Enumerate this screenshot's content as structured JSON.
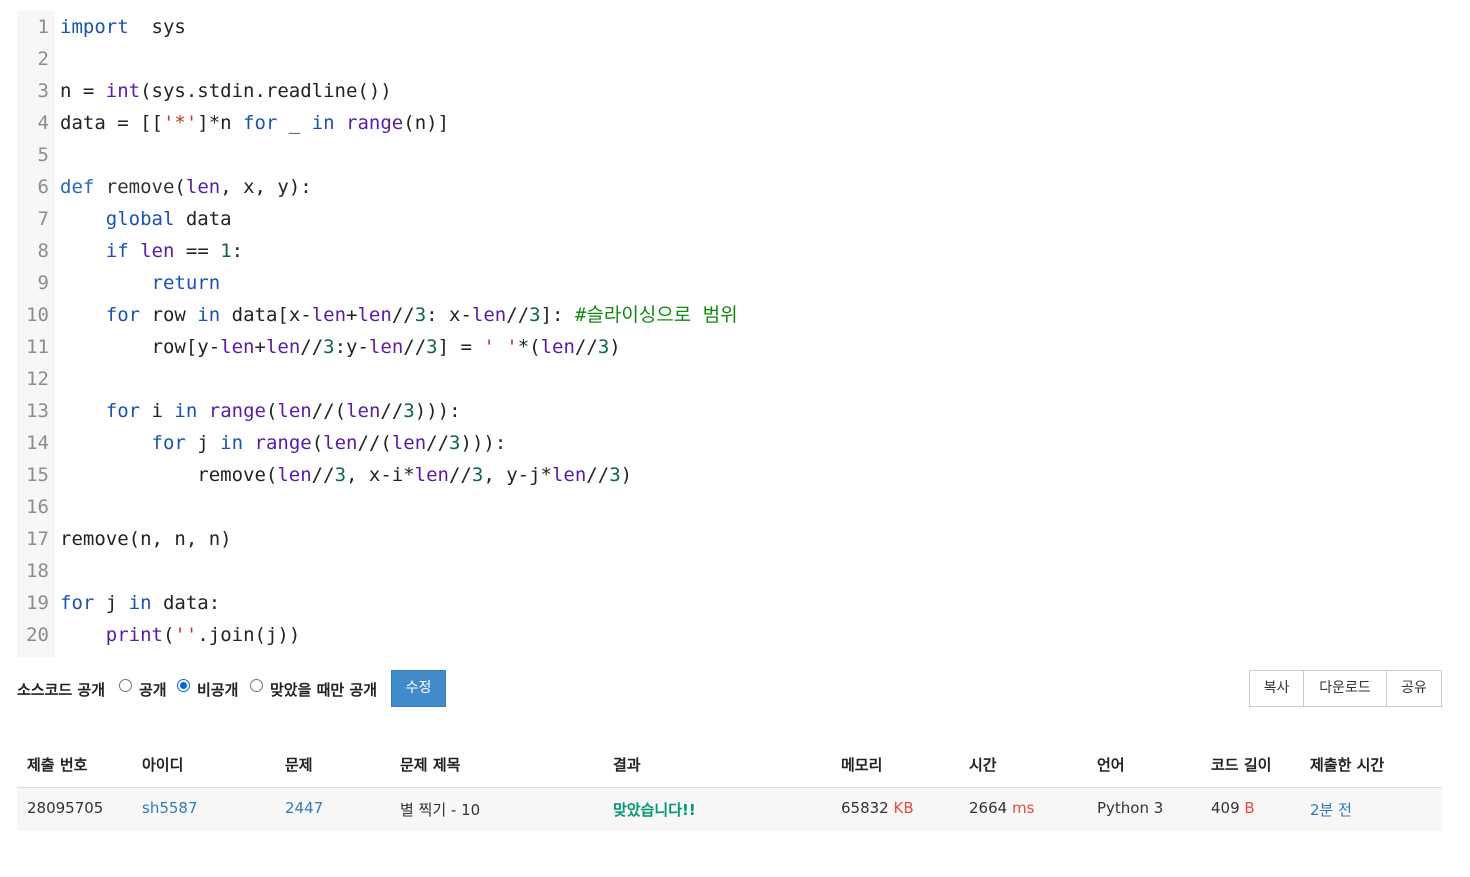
{
  "code": {
    "lines": [
      {
        "n": "1",
        "tokens": [
          [
            "kw",
            "import"
          ],
          [
            "",
            "  sys"
          ]
        ]
      },
      {
        "n": "2",
        "tokens": []
      },
      {
        "n": "3",
        "tokens": [
          [
            "",
            "n = "
          ],
          [
            "bi",
            "int"
          ],
          [
            "",
            "(sys.stdin.readline())"
          ]
        ]
      },
      {
        "n": "4",
        "tokens": [
          [
            "",
            "data = [["
          ],
          [
            "str",
            "'*'"
          ],
          [
            "",
            "]*n "
          ],
          [
            "kw",
            "for"
          ],
          [
            "",
            " _ "
          ],
          [
            "kw",
            "in"
          ],
          [
            "",
            " "
          ],
          [
            "bi",
            "range"
          ],
          [
            "",
            "(n)]"
          ]
        ]
      },
      {
        "n": "5",
        "tokens": []
      },
      {
        "n": "6",
        "tokens": [
          [
            "def",
            "def"
          ],
          [
            "",
            " "
          ],
          [
            "fn",
            "remove"
          ],
          [
            "",
            "("
          ],
          [
            "bi",
            "len"
          ],
          [
            "",
            ", x, y):"
          ]
        ]
      },
      {
        "n": "7",
        "tokens": [
          [
            "",
            "    "
          ],
          [
            "kw",
            "global"
          ],
          [
            "",
            " data"
          ]
        ]
      },
      {
        "n": "8",
        "tokens": [
          [
            "",
            "    "
          ],
          [
            "kw",
            "if"
          ],
          [
            "",
            " "
          ],
          [
            "bi",
            "len"
          ],
          [
            "",
            " == "
          ],
          [
            "num",
            "1"
          ],
          [
            "",
            ":"
          ]
        ]
      },
      {
        "n": "9",
        "tokens": [
          [
            "",
            "        "
          ],
          [
            "kw",
            "return"
          ]
        ]
      },
      {
        "n": "10",
        "tokens": [
          [
            "",
            "    "
          ],
          [
            "kw",
            "for"
          ],
          [
            "",
            " row "
          ],
          [
            "kw",
            "in"
          ],
          [
            "",
            " data[x-"
          ],
          [
            "bi",
            "len"
          ],
          [
            "",
            "+"
          ],
          [
            "bi",
            "len"
          ],
          [
            "",
            "//"
          ],
          [
            "num",
            "3"
          ],
          [
            "",
            ": x-"
          ],
          [
            "bi",
            "len"
          ],
          [
            "",
            "//"
          ],
          [
            "num",
            "3"
          ],
          [
            "",
            "]: "
          ],
          [
            "cm",
            "#슬라이싱으로 범위"
          ]
        ]
      },
      {
        "n": "11",
        "tokens": [
          [
            "",
            "        row[y-"
          ],
          [
            "bi",
            "len"
          ],
          [
            "",
            "+"
          ],
          [
            "bi",
            "len"
          ],
          [
            "",
            "//"
          ],
          [
            "num",
            "3"
          ],
          [
            "",
            ":y-"
          ],
          [
            "bi",
            "len"
          ],
          [
            "",
            "//"
          ],
          [
            "num",
            "3"
          ],
          [
            "",
            "] = "
          ],
          [
            "str",
            "' '"
          ],
          [
            "",
            "*("
          ],
          [
            "bi",
            "len"
          ],
          [
            "",
            "//"
          ],
          [
            "num",
            "3"
          ],
          [
            "",
            ")"
          ]
        ]
      },
      {
        "n": "12",
        "tokens": []
      },
      {
        "n": "13",
        "tokens": [
          [
            "",
            "    "
          ],
          [
            "kw",
            "for"
          ],
          [
            "",
            " i "
          ],
          [
            "kw",
            "in"
          ],
          [
            "",
            " "
          ],
          [
            "bi",
            "range"
          ],
          [
            "",
            "("
          ],
          [
            "bi",
            "len"
          ],
          [
            "",
            "//("
          ],
          [
            "bi",
            "len"
          ],
          [
            "",
            "//"
          ],
          [
            "num",
            "3"
          ],
          [
            "",
            "))):"
          ]
        ]
      },
      {
        "n": "14",
        "tokens": [
          [
            "",
            "        "
          ],
          [
            "kw",
            "for"
          ],
          [
            "",
            " j "
          ],
          [
            "kw",
            "in"
          ],
          [
            "",
            " "
          ],
          [
            "bi",
            "range"
          ],
          [
            "",
            "("
          ],
          [
            "bi",
            "len"
          ],
          [
            "",
            "//("
          ],
          [
            "bi",
            "len"
          ],
          [
            "",
            "//"
          ],
          [
            "num",
            "3"
          ],
          [
            "",
            "))):"
          ]
        ]
      },
      {
        "n": "15",
        "tokens": [
          [
            "",
            "            remove("
          ],
          [
            "bi",
            "len"
          ],
          [
            "",
            "//"
          ],
          [
            "num",
            "3"
          ],
          [
            "",
            ", x-i*"
          ],
          [
            "bi",
            "len"
          ],
          [
            "",
            "//"
          ],
          [
            "num",
            "3"
          ],
          [
            "",
            ", y-j*"
          ],
          [
            "bi",
            "len"
          ],
          [
            "",
            "//"
          ],
          [
            "num",
            "3"
          ],
          [
            "",
            ")"
          ]
        ]
      },
      {
        "n": "16",
        "tokens": []
      },
      {
        "n": "17",
        "tokens": [
          [
            "",
            "remove(n, n, n)"
          ]
        ]
      },
      {
        "n": "18",
        "tokens": []
      },
      {
        "n": "19",
        "tokens": [
          [
            "kw",
            "for"
          ],
          [
            "",
            " j "
          ],
          [
            "kw",
            "in"
          ],
          [
            "",
            " data:"
          ]
        ]
      },
      {
        "n": "20",
        "tokens": [
          [
            "",
            "    "
          ],
          [
            "bi",
            "print"
          ],
          [
            "",
            "("
          ],
          [
            "str",
            "''"
          ],
          [
            "",
            ".join(j))"
          ]
        ]
      }
    ]
  },
  "toolbar": {
    "source_label": "소스코드 공개",
    "options": [
      {
        "label": "공개",
        "checked": false
      },
      {
        "label": "비공개",
        "checked": true
      },
      {
        "label": "맞았을 때만 공개",
        "checked": false
      }
    ],
    "edit_label": "수정",
    "copy_label": "복사",
    "download_label": "다운로드",
    "share_label": "공유"
  },
  "table": {
    "headers": [
      "제출 번호",
      "아이디",
      "문제",
      "문제 제목",
      "결과",
      "메모리",
      "시간",
      "언어",
      "코드 길이",
      "제출한 시간"
    ],
    "row": {
      "submission_id": "28095705",
      "user_id": "sh5587",
      "problem": "2447",
      "problem_title": "별 찍기 - 10",
      "result": "맞았습니다!!",
      "memory": "65832",
      "memory_unit": "KB",
      "time": "2664",
      "time_unit": "ms",
      "language": "Python 3",
      "code_length": "409",
      "code_length_unit": "B",
      "submitted": "2분 전"
    }
  }
}
